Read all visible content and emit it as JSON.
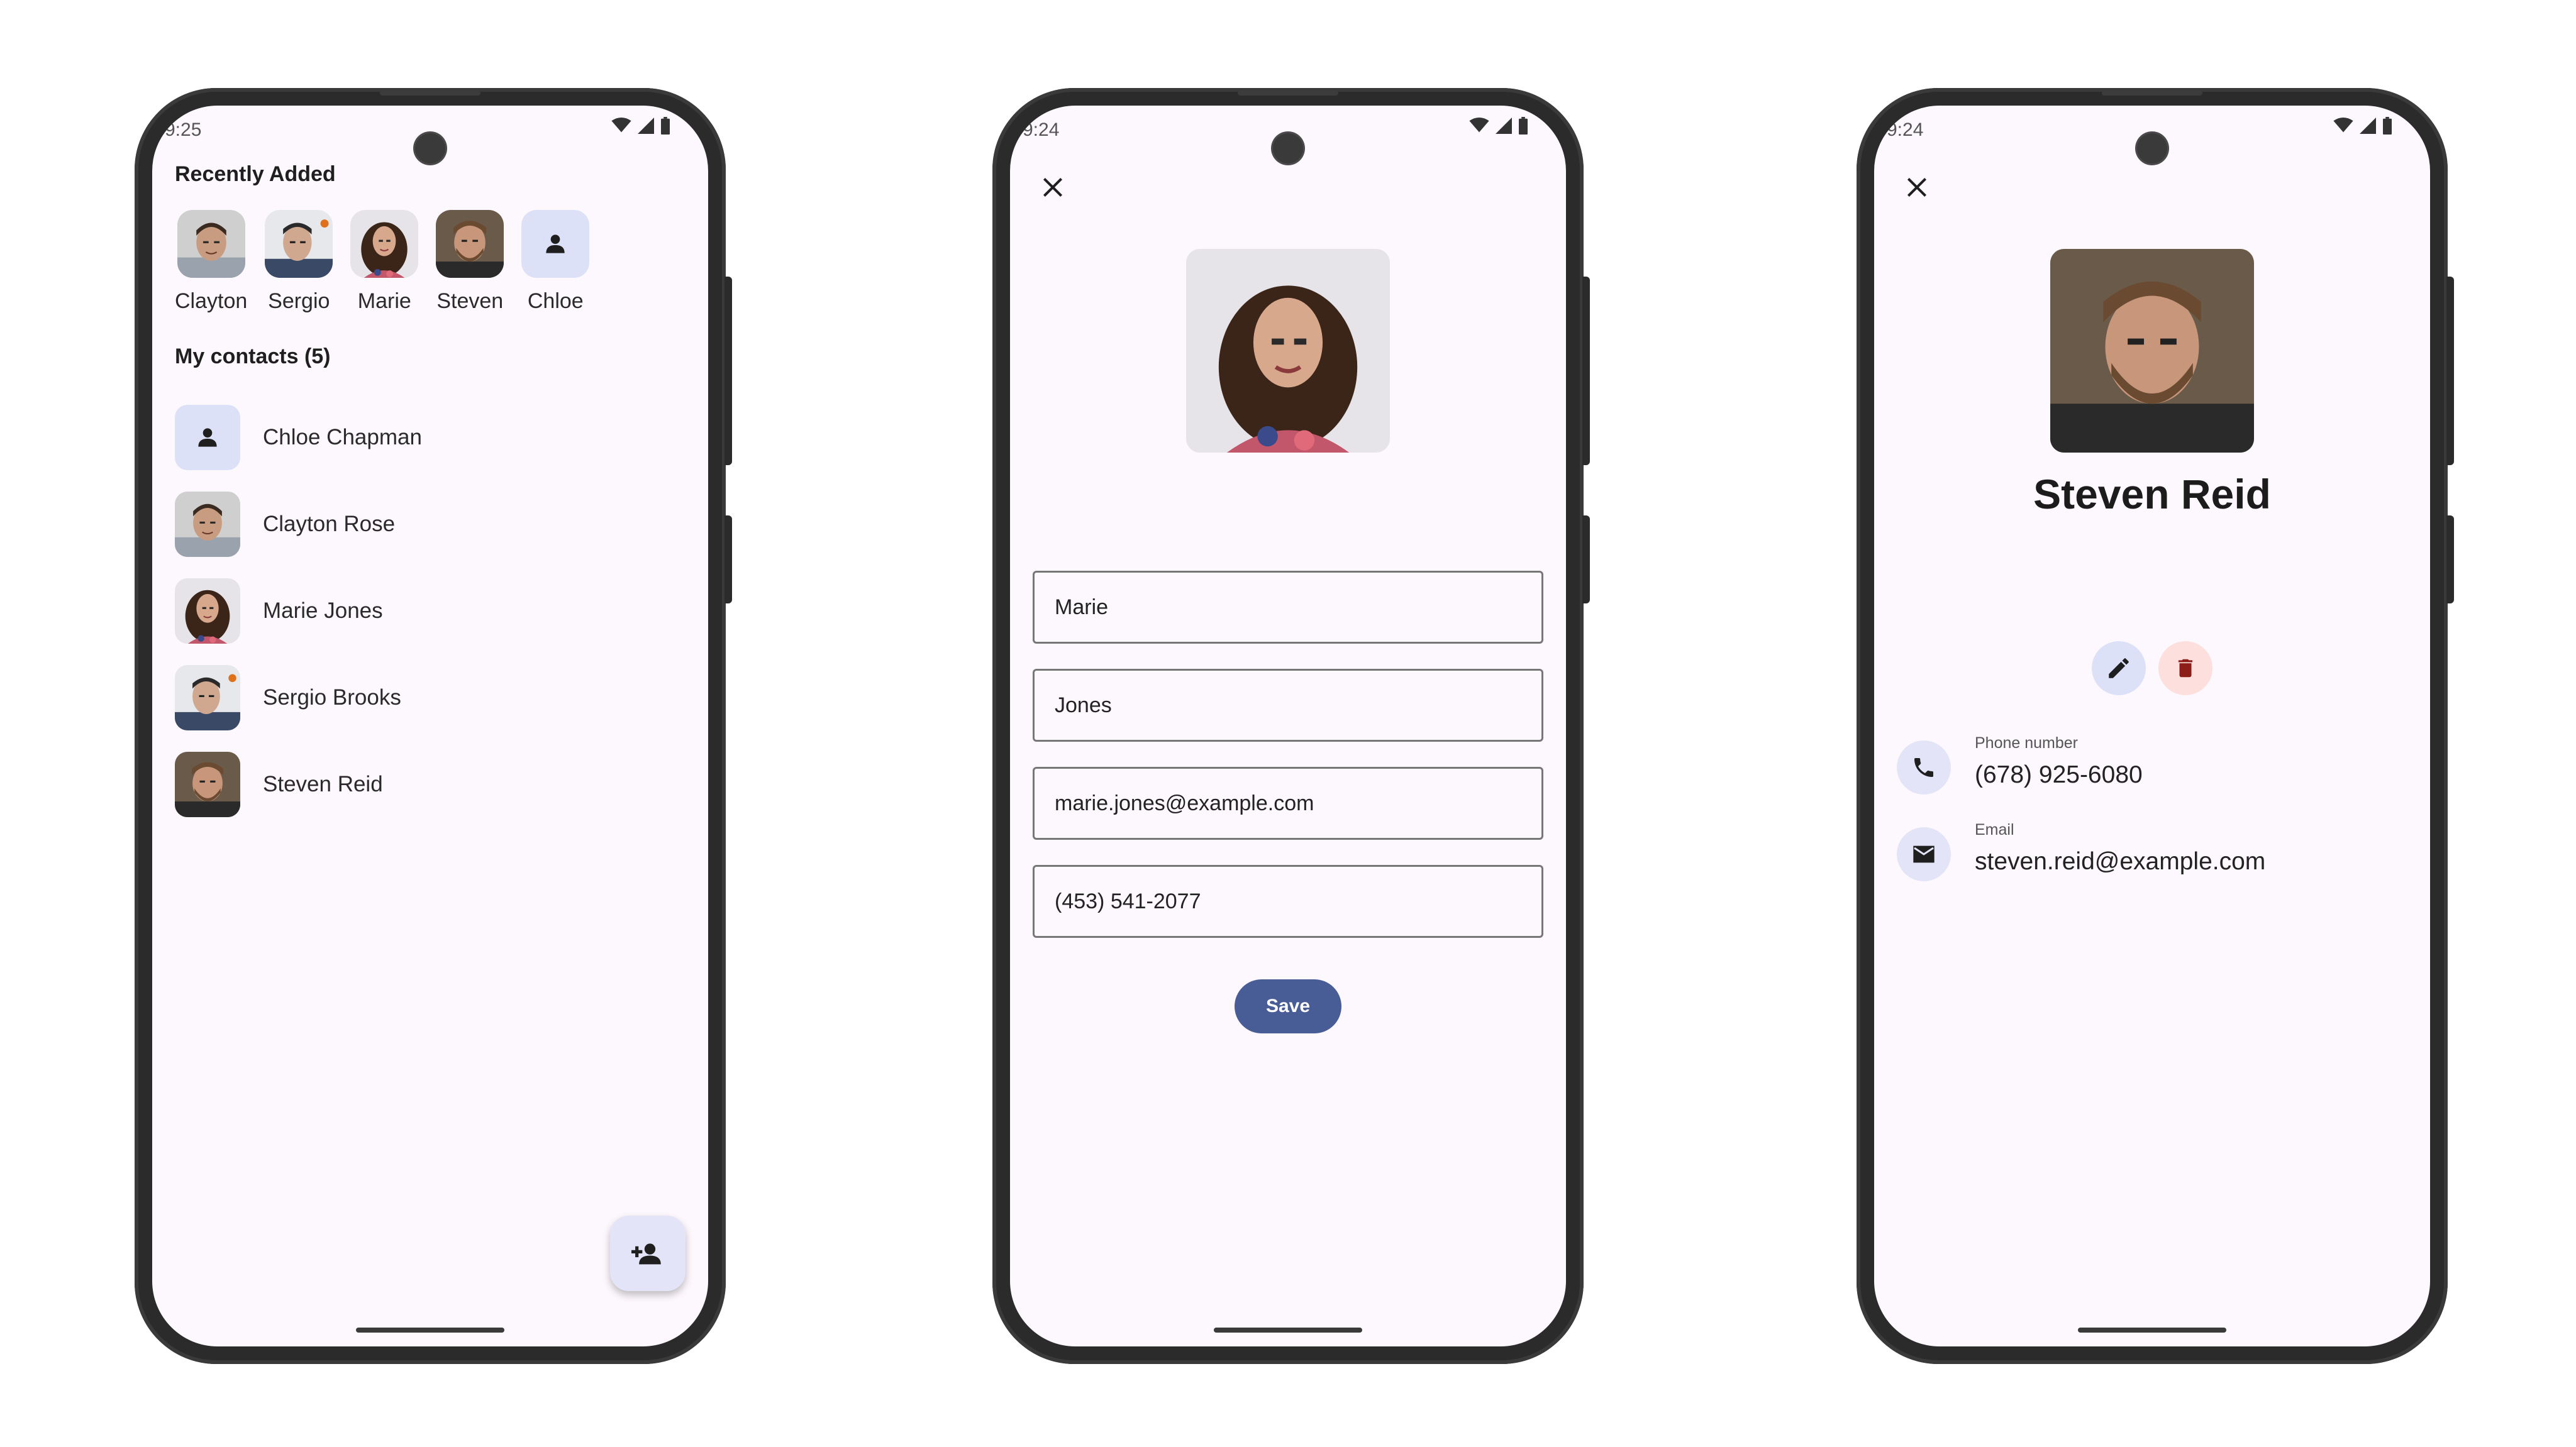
{
  "colors": {
    "screen_bg": "#fdf8fd",
    "accent_container": "#dde1f8",
    "primary": "#485c96",
    "delete_container": "#fde0dd",
    "delete_icon": "#8c1d18"
  },
  "phone1": {
    "status_time": "9:25",
    "recent_title": "Recently Added",
    "recent": [
      {
        "label": "Clayton"
      },
      {
        "label": "Sergio"
      },
      {
        "label": "Marie"
      },
      {
        "label": "Steven"
      },
      {
        "label": "Chloe"
      }
    ],
    "contacts_title": "My contacts (5)",
    "contacts": [
      {
        "name": "Chloe Chapman"
      },
      {
        "name": "Clayton Rose"
      },
      {
        "name": "Marie Jones"
      },
      {
        "name": "Sergio Brooks"
      },
      {
        "name": "Steven Reid"
      }
    ],
    "fab_icon": "person-add-icon"
  },
  "phone2": {
    "status_time": "9:24",
    "first_name": "Marie",
    "last_name": "Jones",
    "email": "marie.jones@example.com",
    "phone": "(453) 541-2077",
    "save_label": "Save"
  },
  "phone3": {
    "status_time": "9:24",
    "name": "Steven Reid",
    "phone_caption": "Phone number",
    "phone_value": "(678) 925-6080",
    "email_caption": "Email",
    "email_value": "steven.reid@example.com"
  }
}
